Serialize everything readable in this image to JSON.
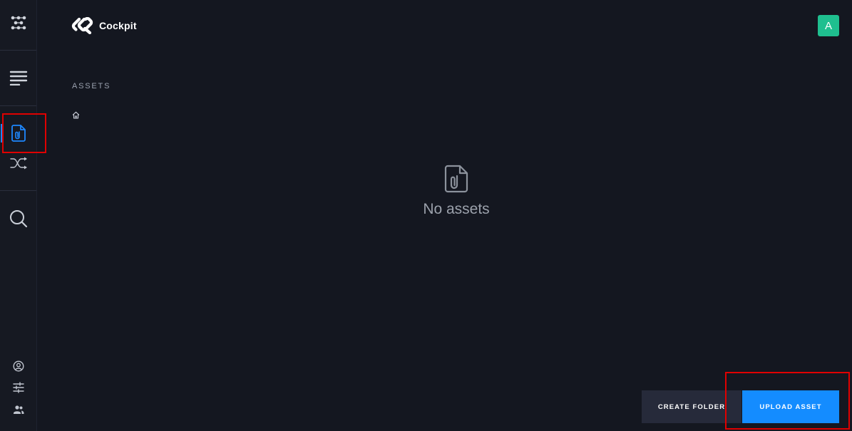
{
  "app": {
    "brand_name": "Cockpit",
    "user_initial": "A"
  },
  "sidebar": {
    "items": [
      {
        "name": "modules",
        "icon": "modules-icon"
      },
      {
        "name": "content",
        "icon": "list-lines-icon"
      },
      {
        "name": "assets",
        "icon": "asset-file-icon",
        "active": true
      },
      {
        "name": "workflows",
        "icon": "shuffle-icon"
      },
      {
        "name": "search",
        "icon": "search-icon"
      }
    ],
    "bottom_items": [
      {
        "name": "account",
        "icon": "user-circle-icon"
      },
      {
        "name": "settings",
        "icon": "sliders-icon"
      },
      {
        "name": "users",
        "icon": "users-icon"
      }
    ]
  },
  "page": {
    "section_title": "ASSETS",
    "breadcrumb_home_icon": "home-icon",
    "empty_state": {
      "icon": "asset-file-icon",
      "text": "No assets"
    }
  },
  "actions": {
    "create_folder_label": "CREATE FOLDER",
    "upload_asset_label": "UPLOAD ASSET"
  },
  "colors": {
    "background": "#141720",
    "accent": "#148cff",
    "avatar": "#1fbf8f",
    "secondary_button": "#262a3a",
    "highlight": "#e00000"
  }
}
